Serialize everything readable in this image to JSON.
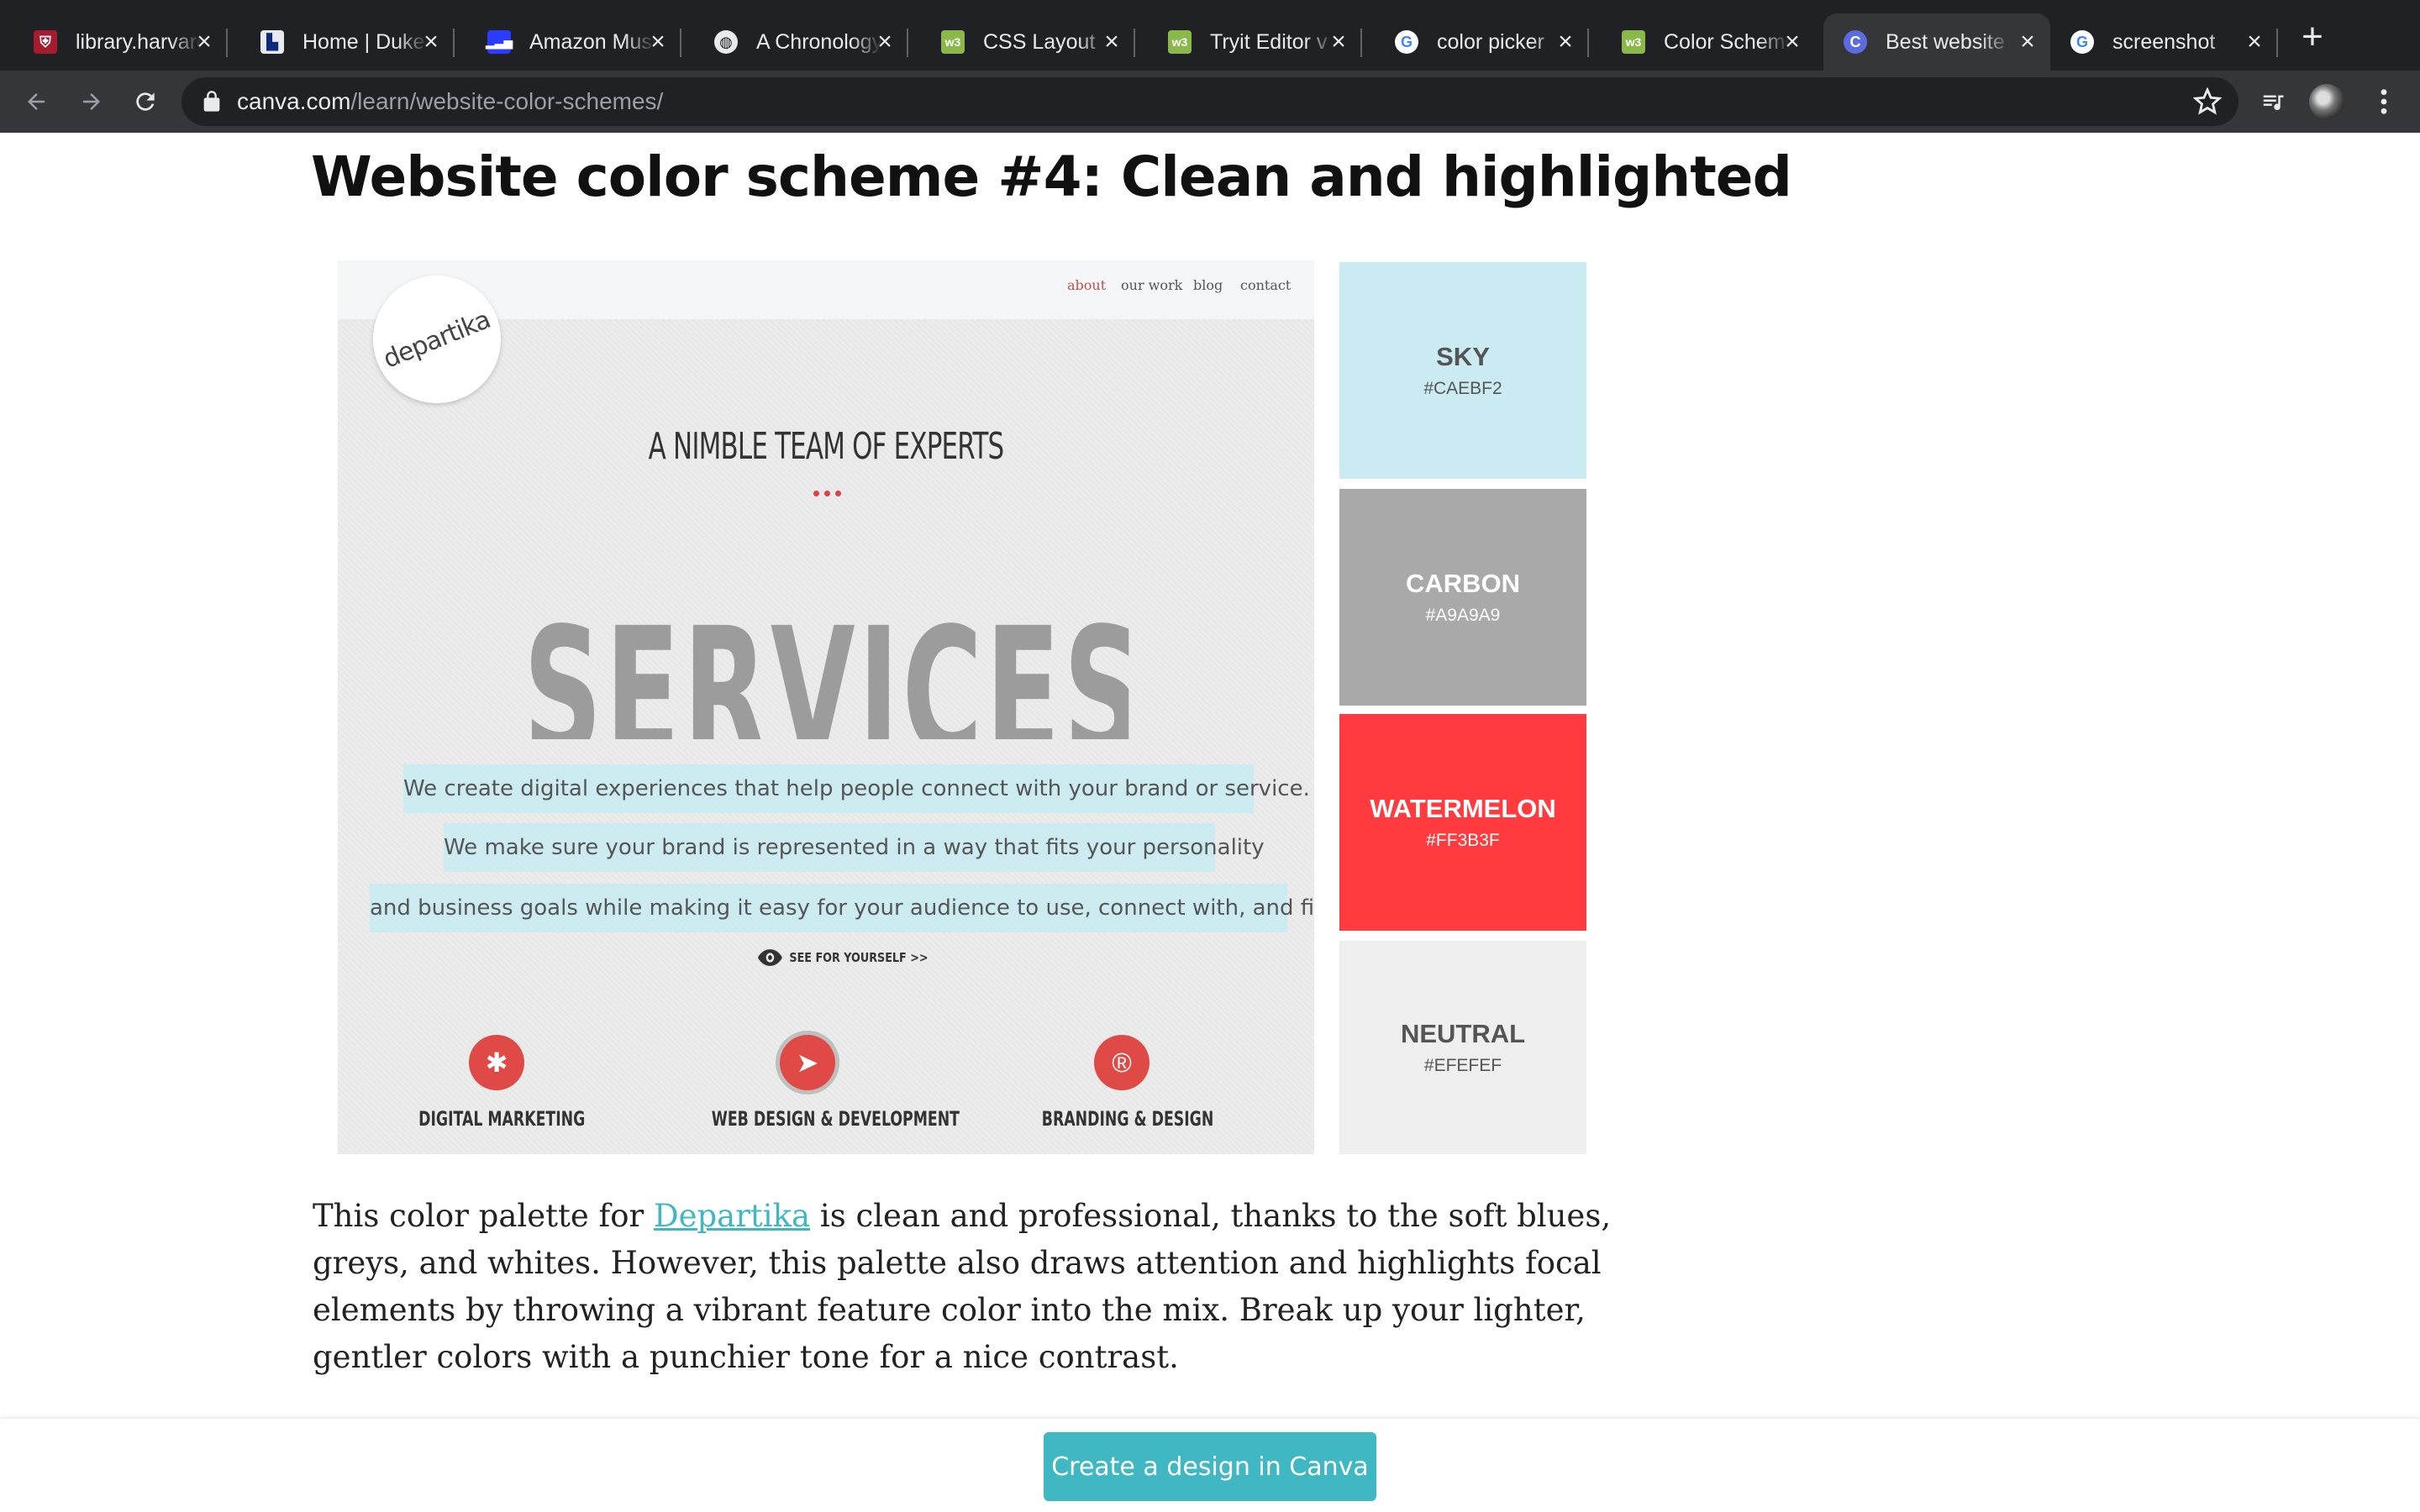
{
  "browser": {
    "tabs": [
      {
        "title": "library.harvard",
        "icon": "harvard-shield-icon",
        "active": false
      },
      {
        "title": "Home | Duke",
        "icon": "duke-icon",
        "active": false
      },
      {
        "title": "Amazon Music",
        "icon": "amazon-music-icon",
        "active": false
      },
      {
        "title": "A Chronology",
        "icon": "globe-icon",
        "active": false
      },
      {
        "title": "CSS Layout",
        "icon": "w3schools-icon",
        "active": false
      },
      {
        "title": "Tryit Editor v",
        "icon": "w3schools-icon",
        "active": false
      },
      {
        "title": "color picker",
        "icon": "google-icon",
        "active": false
      },
      {
        "title": "Color Scheme",
        "icon": "w3schools-icon",
        "active": false
      },
      {
        "title": "Best website",
        "icon": "canva-icon",
        "active": true
      },
      {
        "title": "screenshot",
        "icon": "google-icon",
        "active": false
      }
    ],
    "url_domain": "canva.com",
    "url_path": "/learn/website-color-schemes/"
  },
  "article": {
    "heading": "Website color scheme #4: Clean and highlighted",
    "paragraph_before_link": "This color palette for ",
    "link_text": "Departika",
    "paragraph_after_link": " is clean and professional, thanks to the soft blues, greys, and whites. However, this palette also draws attention and highlights focal elements by throwing a vibrant feature color into the mix. Break up your lighter, gentler colors with a punchier tone for a nice contrast.",
    "cta_label": "Create a design in Canva"
  },
  "screenshot_site": {
    "nav": [
      "about",
      "our work",
      "blog",
      "contact"
    ],
    "logo": "departika",
    "tagline": "A NIMBLE TEAM OF EXPERTS",
    "big_word": "SERVICES",
    "lines": [
      "We create digital experiences that help people connect with your brand or service.",
      "We make sure your brand is represented in a way that fits your personality",
      "and business goals while making it easy for your audience to use, connect with, and find."
    ],
    "see_link": "SEE FOR YOURSELF >>",
    "services": [
      "DIGITAL MARKETING",
      "WEB DESIGN & DEVELOPMENT",
      "BRANDING & DESIGN"
    ]
  },
  "swatches": [
    {
      "name": "SKY",
      "hex": "#CAEBF2",
      "text_color": "#555555"
    },
    {
      "name": "CARBON",
      "hex": "#A9A9A9",
      "text_color": "#ffffff"
    },
    {
      "name": "WATERMELON",
      "hex": "#FF3B3F",
      "text_color": "#ffffff"
    },
    {
      "name": "NEUTRAL",
      "hex": "#EFEFEF",
      "text_color": "#555555"
    }
  ],
  "colors": {
    "accent": "#3fb8c4",
    "chrome_dark": "#202124",
    "chrome_mid": "#35363a"
  }
}
